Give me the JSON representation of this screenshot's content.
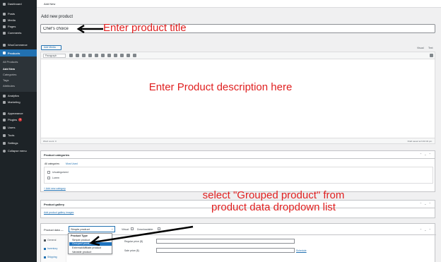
{
  "topbar": {
    "label": "Add New"
  },
  "sidebar": {
    "items": [
      {
        "label": "Dashboard",
        "icon": "dashboard-icon"
      },
      {
        "label": "Posts",
        "icon": "pin-icon"
      },
      {
        "label": "Media",
        "icon": "media-icon"
      },
      {
        "label": "Pages",
        "icon": "page-icon"
      },
      {
        "label": "Comments",
        "icon": "comment-icon"
      },
      {
        "label": "WooCommerce",
        "icon": "woo-icon"
      },
      {
        "label": "Products",
        "icon": "box-icon"
      },
      {
        "label": "Analytics",
        "icon": "chart-icon"
      },
      {
        "label": "Marketing",
        "icon": "megaphone-icon"
      },
      {
        "label": "Appearance",
        "icon": "brush-icon"
      },
      {
        "label": "Plugins",
        "icon": "plugin-icon",
        "badge": "2"
      },
      {
        "label": "Users",
        "icon": "user-icon"
      },
      {
        "label": "Tools",
        "icon": "wrench-icon"
      },
      {
        "label": "Settings",
        "icon": "settings-icon"
      },
      {
        "label": "Collapse menu",
        "icon": "collapse-icon"
      }
    ],
    "products_sub": [
      "All Products",
      "Add New",
      "Categories",
      "Tags",
      "Attributes"
    ]
  },
  "page": {
    "title": "Add new product"
  },
  "title_input": {
    "value": "Chef's choice"
  },
  "editor": {
    "add_media": "Add Media",
    "tab_visual": "Visual",
    "tab_text": "Text",
    "paragraph": "Paragraph",
    "word_count": "Word count: 0",
    "draft_saved": "Draft saved at 9:40:32 pm."
  },
  "annotations": {
    "title": "Enter product title",
    "description": "Enter Product description here",
    "grouped": "select \"Grouped product\" from product data dropdown list"
  },
  "categories_box": {
    "title": "Product categories",
    "tab_all": "All categories",
    "tab_most": "Most Used",
    "items": [
      "Uncategorized",
      "Lorem"
    ],
    "add_link": "+ Add new category"
  },
  "gallery_box": {
    "title": "Product gallery",
    "link": "Add product gallery images"
  },
  "product_data": {
    "label": "Product data —",
    "selected": "Simple product",
    "virtual": "Virtual:",
    "downloadable": "Downloadable:",
    "dropdown_group": "Product Type",
    "options": [
      "Simple product",
      "Grouped product",
      "External/Affiliate product",
      "Variable product"
    ],
    "selected_option_index": 1,
    "tabs": [
      "General",
      "Inventory",
      "Shipping"
    ],
    "regular_price": "Regular price ($)",
    "sale_price": "Sale price ($)",
    "schedule": "Schedule"
  },
  "colors": {
    "annotation": "#e02020",
    "accent": "#2271b1",
    "sidebar": "#1d2327"
  }
}
